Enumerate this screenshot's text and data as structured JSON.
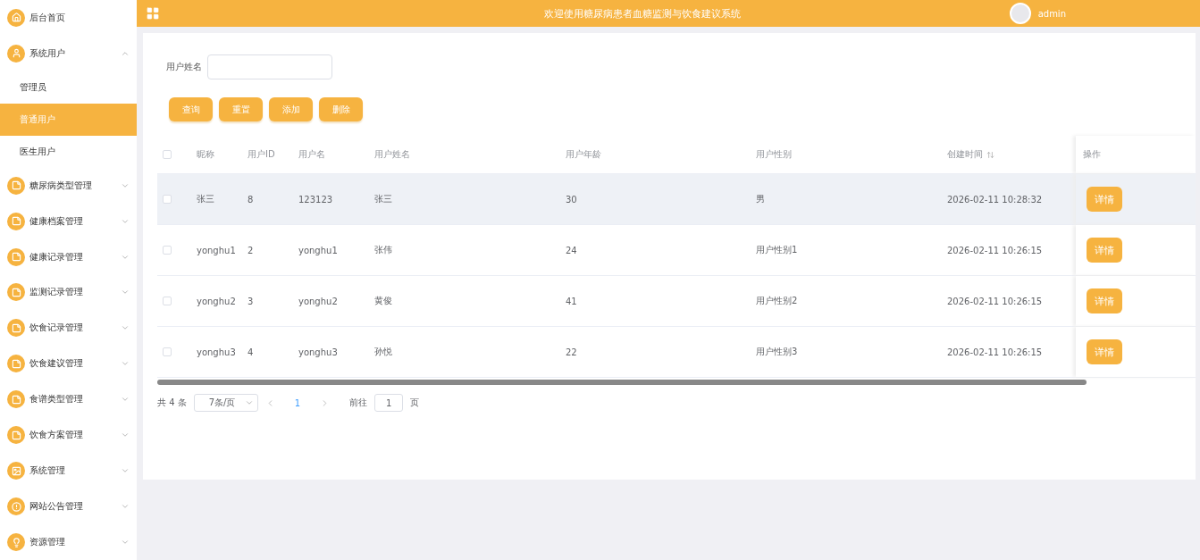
{
  "sidebar": {
    "items": [
      {
        "label": "后台首页",
        "kind": "home",
        "expanded": false
      },
      {
        "label": "系统用户",
        "kind": "user",
        "expanded": true,
        "children": [
          {
            "label": "管理员",
            "selected": false
          },
          {
            "label": "普通用户",
            "selected": true
          },
          {
            "label": "医生用户",
            "selected": false
          }
        ]
      },
      {
        "label": "糖尿病类型管理",
        "kind": "note",
        "expanded": false
      },
      {
        "label": "健康档案管理",
        "kind": "note",
        "expanded": false
      },
      {
        "label": "健康记录管理",
        "kind": "note",
        "expanded": false
      },
      {
        "label": "监测记录管理",
        "kind": "note",
        "expanded": false
      },
      {
        "label": "饮食记录管理",
        "kind": "note",
        "expanded": false
      },
      {
        "label": "饮食建议管理",
        "kind": "note",
        "expanded": false
      },
      {
        "label": "食谱类型管理",
        "kind": "note",
        "expanded": false
      },
      {
        "label": "饮食方案管理",
        "kind": "note",
        "expanded": false
      },
      {
        "label": "系统管理",
        "kind": "image",
        "expanded": false
      },
      {
        "label": "网站公告管理",
        "kind": "info",
        "expanded": false
      },
      {
        "label": "资源管理",
        "kind": "bulb",
        "expanded": false
      }
    ]
  },
  "header": {
    "title": "欢迎使用糖尿病患者血糖监测与饮食建议系统",
    "user": "admin"
  },
  "search": {
    "label": "用户姓名"
  },
  "buttons": [
    "查询",
    "重置",
    "添加",
    "删除"
  ],
  "table": {
    "all_checked": false,
    "columns": [
      {
        "label": "昵称",
        "sortable": false
      },
      {
        "label": "用户ID",
        "sortable": false
      },
      {
        "label": "用户名",
        "sortable": false
      },
      {
        "label": "用户姓名",
        "sortable": false
      },
      {
        "label": "用户年龄",
        "sortable": false
      },
      {
        "label": "用户性别",
        "sortable": false
      },
      {
        "label": "创建时间",
        "sortable": true
      },
      {
        "label": "操作",
        "sortable": false
      }
    ],
    "rows": [
      {
        "checked": false,
        "selected": true,
        "cells": [
          "张三",
          "8",
          "123123",
          "张三",
          "30",
          "男",
          "2026-02-11 10:28:32"
        ],
        "action": "详情"
      },
      {
        "checked": false,
        "selected": false,
        "cells": [
          "yonghu1",
          "2",
          "yonghu1",
          "张伟",
          "24",
          "用户性别1",
          "2026-02-11 10:26:15"
        ],
        "action": "详情"
      },
      {
        "checked": false,
        "selected": false,
        "cells": [
          "yonghu2",
          "3",
          "yonghu2",
          "黄俊",
          "41",
          "用户性别2",
          "2026-02-11 10:26:15"
        ],
        "action": "详情"
      },
      {
        "checked": false,
        "selected": false,
        "cells": [
          "yonghu3",
          "4",
          "yonghu3",
          "孙悦",
          "22",
          "用户性别3",
          "2026-02-11 10:26:15"
        ],
        "action": "详情"
      }
    ]
  },
  "pagination": {
    "total": "共 4 条",
    "page_size": "7条/页",
    "pages": [
      {
        "label": "1",
        "selected": true
      }
    ],
    "goto_label": "前往",
    "goto_value": "1",
    "goto_suffix": "页"
  }
}
